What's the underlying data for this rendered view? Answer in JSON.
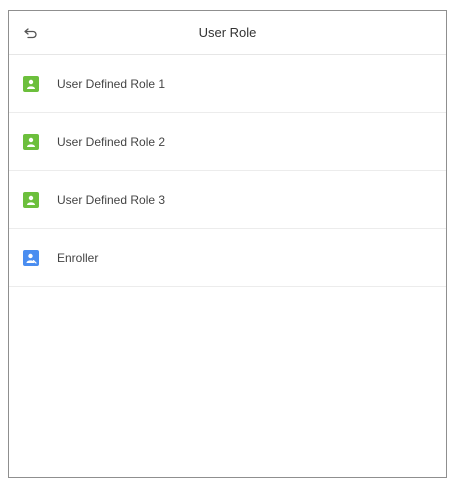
{
  "header": {
    "title": "User Role",
    "back_icon": "back-arrow-icon"
  },
  "roles": [
    {
      "label": "User Defined Role 1",
      "icon": "user-icon",
      "color": "#6cbf3c"
    },
    {
      "label": "User Defined Role 2",
      "icon": "user-icon",
      "color": "#6cbf3c"
    },
    {
      "label": "User Defined Role 3",
      "icon": "user-icon",
      "color": "#6cbf3c"
    },
    {
      "label": "Enroller",
      "icon": "enroller-user-icon",
      "color": "#4a8df0"
    }
  ]
}
